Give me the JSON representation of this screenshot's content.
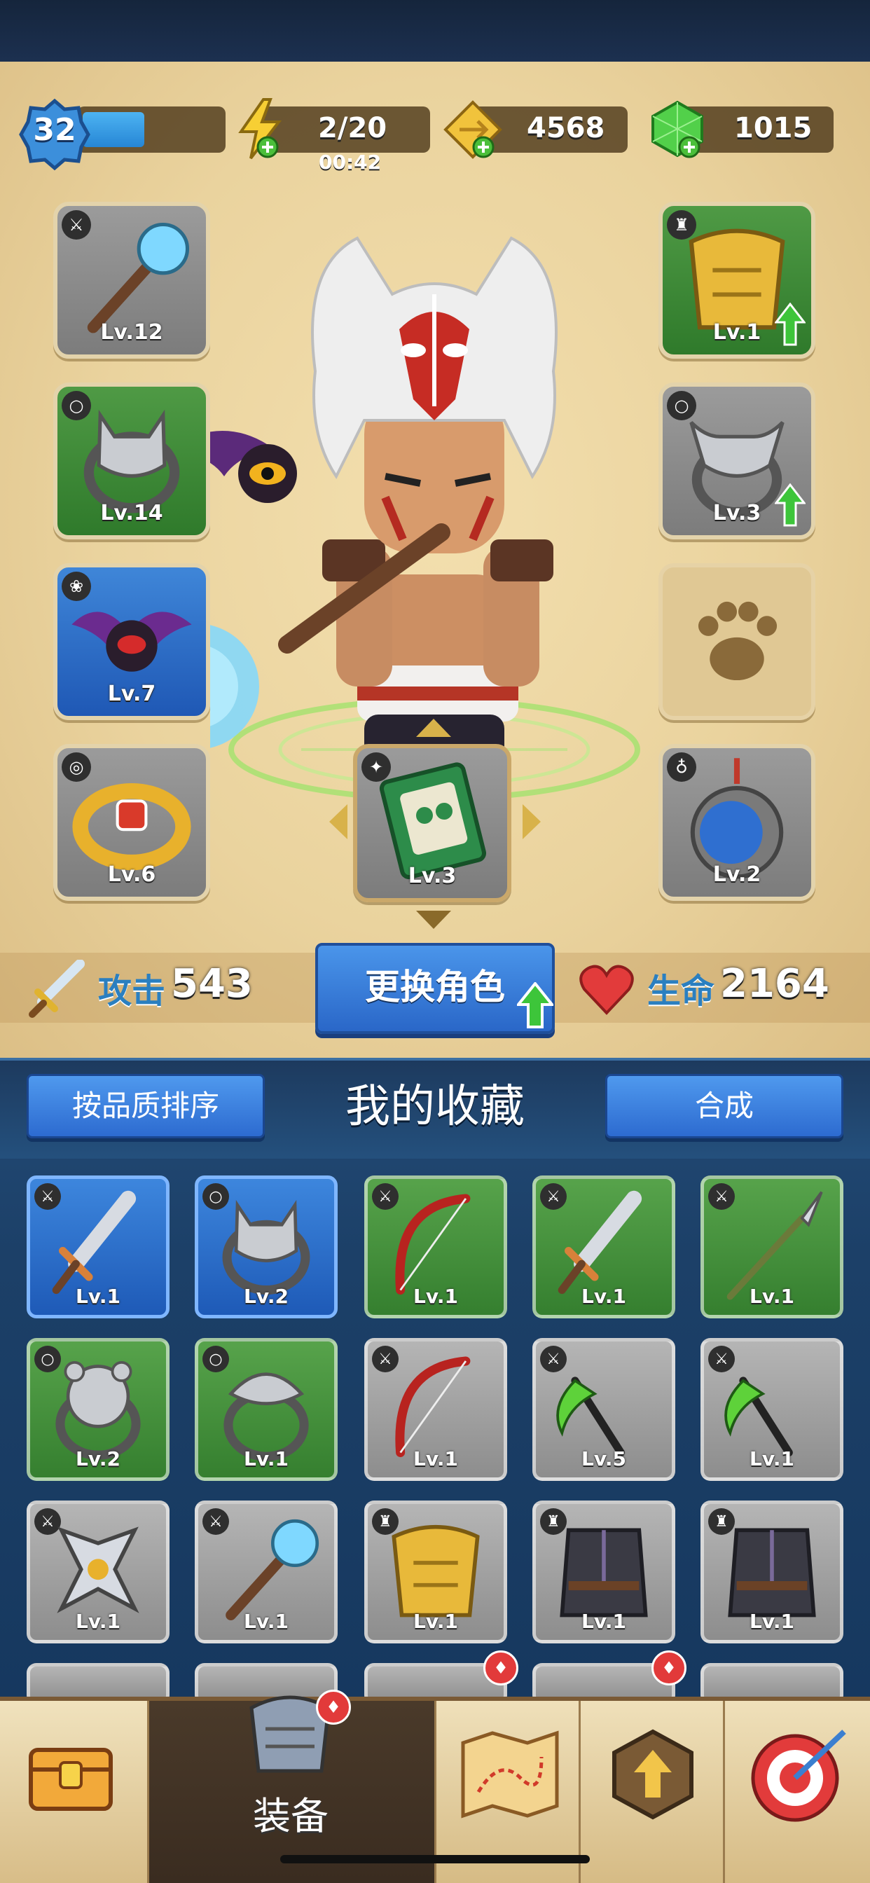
{
  "hud": {
    "player_level": "32",
    "xp_fill": 0.45,
    "energy": "2/20",
    "energy_timer": "00:42",
    "gold": "4568",
    "gems": "1015"
  },
  "equipment": {
    "left": [
      {
        "level": "Lv.12",
        "rarity": "gray",
        "icon": "staff-icon",
        "category": "weapon"
      },
      {
        "level": "Lv.14",
        "rarity": "green",
        "icon": "wolf-ring-icon",
        "category": "ring"
      },
      {
        "level": "Lv.7",
        "rarity": "blue",
        "icon": "bat-pet-icon",
        "category": "pet"
      },
      {
        "level": "Lv.6",
        "rarity": "gray",
        "icon": "bracelet-icon",
        "category": "bracelet"
      }
    ],
    "right": [
      {
        "level": "Lv.1",
        "rarity": "green",
        "icon": "gold-armor-icon",
        "category": "armor",
        "upgrade": true
      },
      {
        "level": "Lv.3",
        "rarity": "gray",
        "icon": "bull-ring-icon",
        "category": "ring",
        "upgrade": true
      },
      {
        "level": "",
        "rarity": "empty",
        "icon": "paw-icon",
        "category": "pet"
      },
      {
        "level": "Lv.2",
        "rarity": "gray",
        "icon": "eagle-amulet-icon",
        "category": "amulet"
      }
    ],
    "center": {
      "level": "Lv.3",
      "rarity": "gray",
      "icon": "owl-book-icon",
      "category": "book"
    }
  },
  "stats": {
    "attack_label": "攻击",
    "attack_value": "543",
    "change_character": "更换角色",
    "hp_label": "生命",
    "hp_value": "2164"
  },
  "collection": {
    "sort_button": "按品质排序",
    "title": "我的收藏",
    "merge_button": "合成",
    "items": [
      {
        "level": "Lv.1",
        "rarity": "blue",
        "icon": "spiked-sword-icon"
      },
      {
        "level": "Lv.2",
        "rarity": "blue",
        "icon": "wolf-ring-icon"
      },
      {
        "level": "Lv.1",
        "rarity": "green",
        "icon": "bow-icon"
      },
      {
        "level": "Lv.1",
        "rarity": "green",
        "icon": "spiked-sword-icon"
      },
      {
        "level": "Lv.1",
        "rarity": "green",
        "icon": "spear-icon"
      },
      {
        "level": "Lv.2",
        "rarity": "green",
        "icon": "bear-ring-icon"
      },
      {
        "level": "Lv.1",
        "rarity": "green",
        "icon": "snake-ring-icon"
      },
      {
        "level": "Lv.1",
        "rarity": "gray",
        "icon": "bow-icon"
      },
      {
        "level": "Lv.5",
        "rarity": "gray",
        "icon": "scythes-icon"
      },
      {
        "level": "Lv.1",
        "rarity": "gray",
        "icon": "scythes-icon"
      },
      {
        "level": "Lv.1",
        "rarity": "gray",
        "icon": "shuriken-icon"
      },
      {
        "level": "Lv.1",
        "rarity": "gray",
        "icon": "staff-icon"
      },
      {
        "level": "Lv.1",
        "rarity": "gray",
        "icon": "gold-armor-icon"
      },
      {
        "level": "Lv.1",
        "rarity": "gray",
        "icon": "robe-icon"
      },
      {
        "level": "Lv.1",
        "rarity": "gray",
        "icon": "robe-icon"
      }
    ]
  },
  "nav": {
    "equipment_label": "装备"
  },
  "colors": {
    "parchment": "#ead39e",
    "blue_button": "#2d6bd0",
    "attack_label": "#2a7fc0"
  }
}
